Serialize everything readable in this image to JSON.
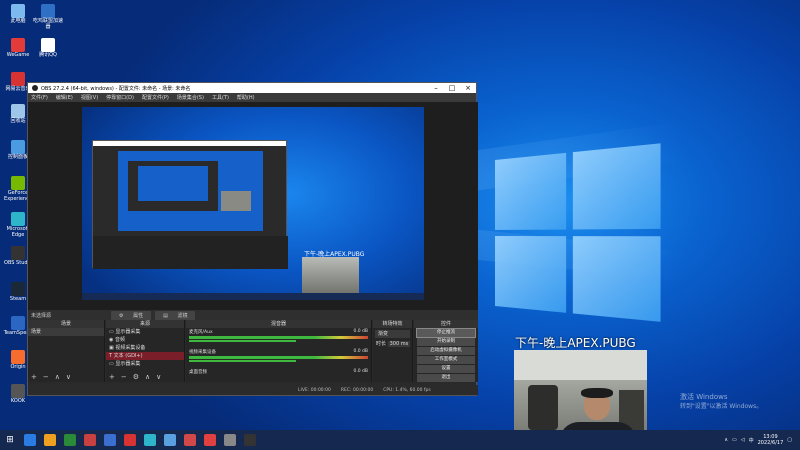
{
  "desktop_icons": [
    {
      "label": "此电脑",
      "color": "#7bb9ee"
    },
    {
      "label": "吃鸡联盟加速器",
      "color": "#2f6fc4"
    },
    {
      "label": "WeGame",
      "color": "#e33a3a"
    },
    {
      "label": "腾讯QQ",
      "color": "#ffffff"
    },
    {
      "label": "网易云音乐",
      "color": "#d83333"
    },
    {
      "label": "回收站",
      "color": "#9ec6e8"
    },
    {
      "label": "控制面板",
      "color": "#4a9be0"
    },
    {
      "label": "GeForce Experience",
      "color": "#76b900"
    },
    {
      "label": "Microsoft Edge",
      "color": "#2fb5c9"
    },
    {
      "label": "OBS Studio",
      "color": "#333333"
    },
    {
      "label": "Steam",
      "color": "#1b2838"
    },
    {
      "label": "TeamSpeak",
      "color": "#2a66c2"
    },
    {
      "label": "Origin",
      "color": "#f56c2d"
    },
    {
      "label": "KOOK",
      "color": "#555555"
    }
  ],
  "obs": {
    "title": "OBS 27.2.4 (64-bit, windows) - 配置文件: 未命名 - 场景: 未命名",
    "menu": [
      "文件(F)",
      "编辑(E)",
      "视图(V)",
      "停靠窗口(D)",
      "配置文件(P)",
      "场景集合(S)",
      "工具(T)",
      "帮助(H)"
    ],
    "no_source_selected": "未选择源",
    "properties_label": "属性",
    "filters_label": "滤镜",
    "scenes_header": "场景",
    "scenes": [
      "场景"
    ],
    "sources_header": "来源",
    "sources": [
      "显示器采集",
      "音频",
      "视频采集设备",
      "文本 (GDI+)",
      "显示器采集"
    ],
    "mixer_header": "混音器",
    "mixer": [
      {
        "name": "麦克风/Aux",
        "db": "0.0 dB"
      },
      {
        "name": "视频采集设备",
        "db": "0.0 dB"
      },
      {
        "name": "桌面音频",
        "db": "0.0 dB"
      }
    ],
    "transitions_header": "转场特效",
    "transition_type": "渐变",
    "duration_label": "时长",
    "duration_value": "300 ms",
    "controls_header": "控件",
    "controls": [
      "停止推流",
      "开始录制",
      "启动虚拟摄像机",
      "工作室模式",
      "设置",
      "退出"
    ],
    "status": [
      "LIVE: 00:00:00",
      "REC: 00:00:00",
      "CPU: 1.4%, 60.00 fps"
    ]
  },
  "preview_overlay_text": "下午-晚上APEX.PUBG",
  "streamer_title": "下午-晚上APEX.PUBG",
  "activate_windows": [
    "激活 Windows",
    "转到\"设置\"以激活 Windows。"
  ],
  "taskbar": {
    "time": "13:09",
    "date": "2022/6/17",
    "apps": [
      "#2b7be4",
      "#f0a020",
      "#2a8a3a",
      "#c84040",
      "#3a6fd0",
      "#d83333",
      "#2fb5c9",
      "#5aa0e0",
      "#d04848",
      "#e04040",
      "#888888",
      "#333333"
    ]
  }
}
